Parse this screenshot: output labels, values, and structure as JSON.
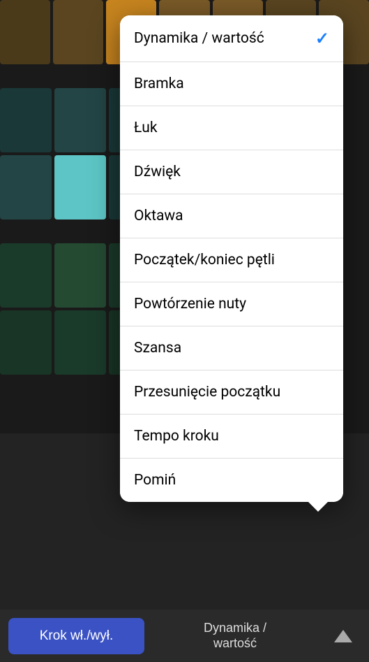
{
  "menu": {
    "items": [
      {
        "label": "Dynamika / wartość",
        "selected": true
      },
      {
        "label": "Bramka",
        "selected": false
      },
      {
        "label": "Łuk",
        "selected": false
      },
      {
        "label": "Dźwięk",
        "selected": false
      },
      {
        "label": "Oktawa",
        "selected": false
      },
      {
        "label": "Początek/koniec pętli",
        "selected": false
      },
      {
        "label": "Powtórzenie nuty",
        "selected": false
      },
      {
        "label": "Szansa",
        "selected": false
      },
      {
        "label": "Przesunięcie początku",
        "selected": false
      },
      {
        "label": "Tempo kroku",
        "selected": false
      },
      {
        "label": "Pomiń",
        "selected": false
      }
    ]
  },
  "bottomBar": {
    "stepToggle": "Krok wł./wył.",
    "modeLabel": "Dynamika /\nwartość"
  }
}
